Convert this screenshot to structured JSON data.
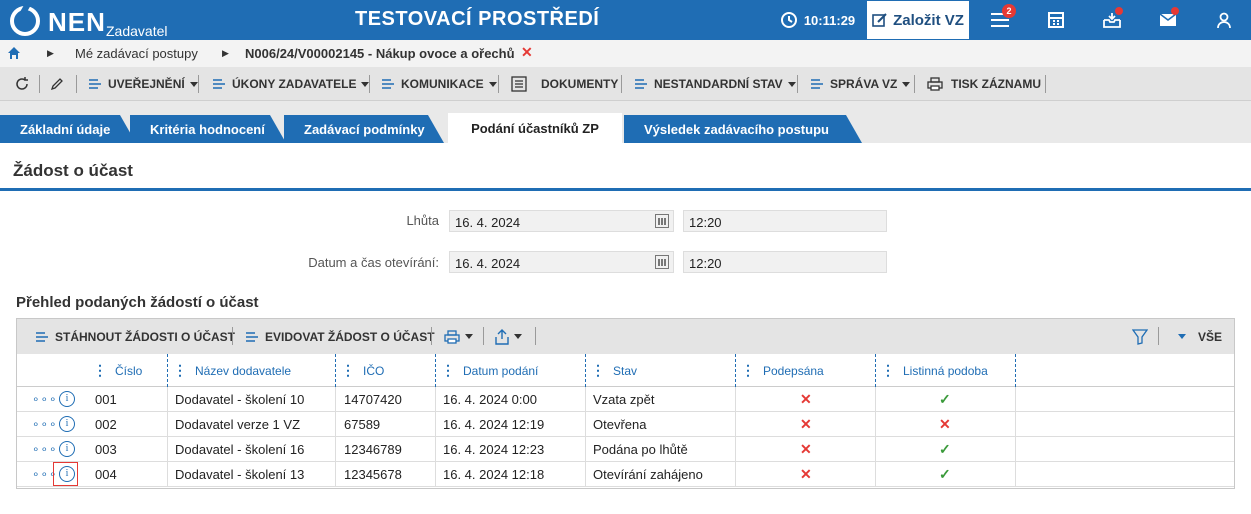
{
  "app": {
    "logo": "NEN",
    "logo_sub": "Zadavatel",
    "env_title": "TESTOVACÍ PROSTŘEDÍ",
    "time": "10:11:29",
    "create_label": "Založit VZ",
    "menu_badge": "2"
  },
  "breadcrumb": {
    "item1": "Mé zadávací postupy",
    "item2": "N006/24/V00002145 - Nákup ovoce a ořechů"
  },
  "toolbar": {
    "uverejneni": "UVEŘEJNĚNÍ",
    "ukony": "ÚKONY ZADAVATELE",
    "komunikace": "KOMUNIKACE",
    "dokumenty": "DOKUMENTY",
    "nestandardni": "NESTANDARDNÍ STAV",
    "sprava": "SPRÁVA VZ",
    "tisk": "TISK ZÁZNAMU"
  },
  "tabs": [
    "Základní údaje",
    "Kritéria hodnocení",
    "Zadávací podmínky",
    "Podání účastníků ZP",
    "Výsledek zadávacího postupu"
  ],
  "section_title": "Žádost o účast",
  "form": {
    "lhuta_label": "Lhůta",
    "lhuta_date": "16. 4. 2024",
    "lhuta_time": "12:20",
    "otevirani_label": "Datum a čas otevírání:",
    "otevirani_date": "16. 4. 2024",
    "otevirani_time": "12:20"
  },
  "grid": {
    "title": "Přehled podaných žádostí o účast",
    "btn_download": "STÁHNOUT ŽÁDOSTI O ÚČAST",
    "btn_record": "EVIDOVAT ŽÁDOST O ÚČAST",
    "btn_all": "VŠE",
    "columns": [
      "Číslo",
      "Název dodavatele",
      "IČO",
      "Datum podání",
      "Stav",
      "Podepsána",
      "Listinná podoba"
    ],
    "rows": [
      {
        "cislo": "001",
        "nazev": "Dodavatel - školení 10",
        "ico": "14707420",
        "datum": "16. 4. 2024 0:00",
        "stav": "Vzata zpět",
        "podepsana": "✕",
        "listinna": "✓"
      },
      {
        "cislo": "002",
        "nazev": "Dodavatel verze 1 VZ",
        "ico": "67589",
        "datum": "16. 4. 2024 12:19",
        "stav": "Otevřena",
        "podepsana": "✕",
        "listinna": "✕"
      },
      {
        "cislo": "003",
        "nazev": "Dodavatel - školení 16",
        "ico": "12346789",
        "datum": "16. 4. 2024 12:23",
        "stav": "Podána po lhůtě",
        "podepsana": "✕",
        "listinna": "✓"
      },
      {
        "cislo": "004",
        "nazev": "Dodavatel - školení 13",
        "ico": "12345678",
        "datum": "16. 4. 2024 12:18",
        "stav": "Otevírání zahájeno",
        "podepsana": "✕",
        "listinna": "✓"
      }
    ]
  },
  "colors": {
    "brand": "#1f6db4",
    "error": "#e53935",
    "success": "#3a9a3a"
  }
}
